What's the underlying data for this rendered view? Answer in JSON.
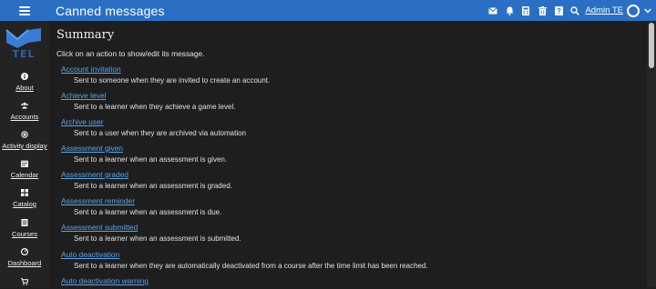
{
  "header": {
    "title": "Canned messages",
    "user_name": "Admin TE",
    "icons": [
      "mail-icon",
      "bell-icon",
      "calculator-icon",
      "trash-icon",
      "help-icon",
      "search-icon"
    ]
  },
  "sidebar": {
    "logo_text": "TEL",
    "items": [
      {
        "label": "About",
        "icon": "info-icon"
      },
      {
        "label": "Accounts",
        "icon": "users-icon"
      },
      {
        "label": "Activity display",
        "icon": "dot-icon"
      },
      {
        "label": "Calendar",
        "icon": "calendar-icon"
      },
      {
        "label": "Catalog",
        "icon": "grid-icon"
      },
      {
        "label": "Courses",
        "icon": "book-icon"
      },
      {
        "label": "Dashboard",
        "icon": "gauge-icon"
      },
      {
        "label": "",
        "icon": "cart-icon"
      }
    ]
  },
  "main": {
    "title": "Summary",
    "instructions": "Click on an action to show/edit its message.",
    "messages": [
      {
        "title": "Account invitation",
        "description": "Sent to someone when they are invited to create an account."
      },
      {
        "title": "Achieve level",
        "description": "Sent to a learner when they achieve a game level."
      },
      {
        "title": "Archive user",
        "description": "Sent to a user when they are archived via automation"
      },
      {
        "title": "Assessment given",
        "description": "Sent to a learner when an assessment is given."
      },
      {
        "title": "Assessment graded",
        "description": "Sent to a learner when an assessment is graded."
      },
      {
        "title": "Assessment reminder",
        "description": "Sent to a learner when an assessment is due."
      },
      {
        "title": "Assessment submitted",
        "description": "Sent to a learner when an assessment is submitted."
      },
      {
        "title": "Auto deactivation",
        "description": "Sent to a learner when they are automatically deactivated from a course after the time limit has been reached."
      },
      {
        "title": "Auto deactivation warning",
        "description": ""
      }
    ]
  },
  "colors": {
    "topbar": "#2a6fc4",
    "background": "#1e1e1e",
    "sidebar": "#232323",
    "link": "#5ba4e6",
    "logo": "#3a7bd5"
  }
}
